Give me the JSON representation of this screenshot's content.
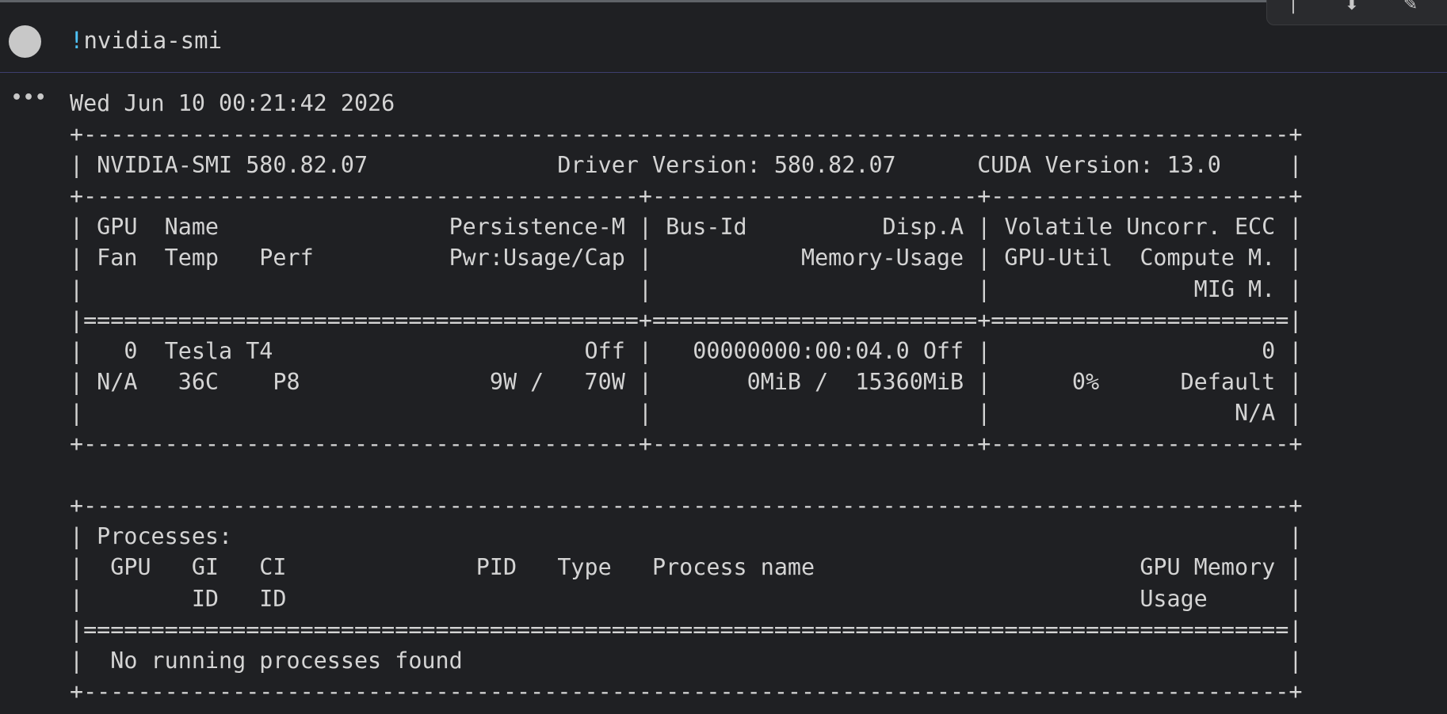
{
  "cell": {
    "bang": "!",
    "command": "nvidia-smi"
  },
  "toolbar": {
    "items": [
      "|",
      "⬇",
      "✎"
    ]
  },
  "output": {
    "lines": [
      "Wed Jun 10 00:21:42 2026",
      "+-----------------------------------------------------------------------------------------+",
      "| NVIDIA-SMI 580.82.07              Driver Version: 580.82.07      CUDA Version: 13.0     |",
      "+-----------------------------------------+------------------------+----------------------+",
      "| GPU  Name                 Persistence-M | Bus-Id          Disp.A | Volatile Uncorr. ECC |",
      "| Fan  Temp   Perf          Pwr:Usage/Cap |           Memory-Usage | GPU-Util  Compute M. |",
      "|                                         |                        |               MIG M. |",
      "|=========================================+========================+======================|",
      "|   0  Tesla T4                       Off |   00000000:00:04.0 Off |                    0 |",
      "| N/A   36C    P8              9W /   70W |       0MiB /  15360MiB |      0%      Default |",
      "|                                         |                        |                  N/A |",
      "+-----------------------------------------+------------------------+----------------------+",
      "",
      "+-----------------------------------------------------------------------------------------+",
      "| Processes:                                                                              |",
      "|  GPU   GI   CI              PID   Type   Process name                        GPU Memory |",
      "|        ID   ID                                                               Usage      |",
      "|=========================================================================================|",
      "|  No running processes found                                                             |",
      "+-----------------------------------------------------------------------------------------+"
    ]
  }
}
